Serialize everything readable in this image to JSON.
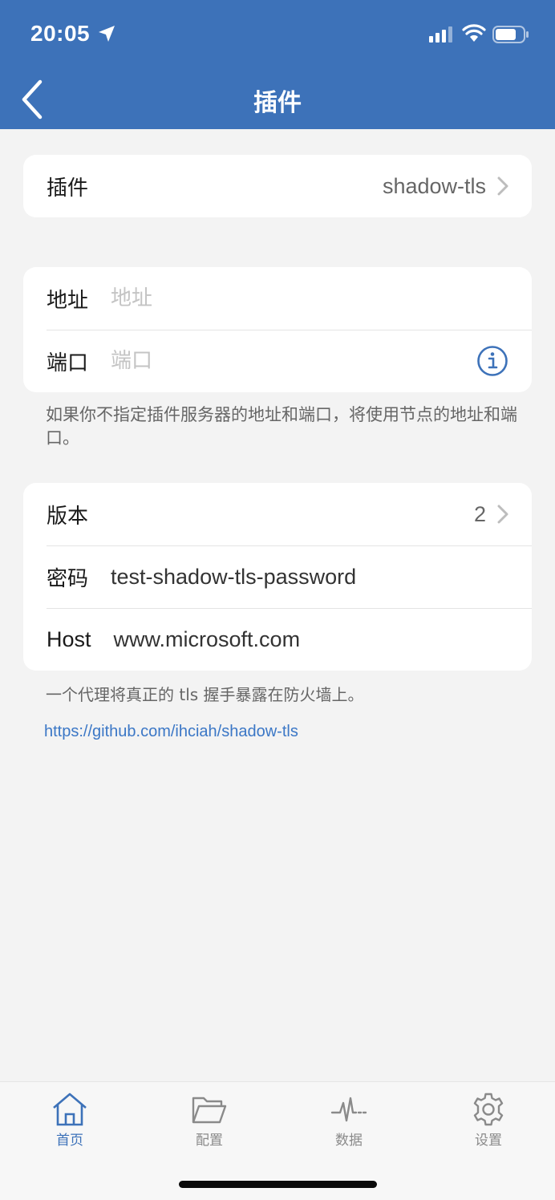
{
  "status_bar": {
    "time": "20:05"
  },
  "nav": {
    "title": "插件"
  },
  "plugin_card": {
    "label": "插件",
    "value": "shadow-tls"
  },
  "address_card": {
    "address": {
      "label": "地址",
      "placeholder": "地址",
      "value": ""
    },
    "port": {
      "label": "端口",
      "placeholder": "端口",
      "value": ""
    }
  },
  "address_note": "如果你不指定插件服务器的地址和端口，将使用节点的地址和端口。",
  "settings_card": {
    "version": {
      "label": "版本",
      "value": "2"
    },
    "password": {
      "label": "密码",
      "value": "test-shadow-tls-password"
    },
    "host": {
      "label": "Host",
      "value": "www.microsoft.com"
    }
  },
  "description": "一个代理将真正的 tls 握手暴露在防火墙上。",
  "link": "https://github.com/ihciah/shadow-tls",
  "tabs": [
    {
      "label": "首页",
      "icon": "home-icon",
      "active": true
    },
    {
      "label": "配置",
      "icon": "folder-icon",
      "active": false
    },
    {
      "label": "数据",
      "icon": "pulse-icon",
      "active": false
    },
    {
      "label": "设置",
      "icon": "gear-icon",
      "active": false
    }
  ],
  "colors": {
    "accent": "#3d72b9",
    "link": "#3b77c6",
    "background": "#f3f3f3"
  }
}
